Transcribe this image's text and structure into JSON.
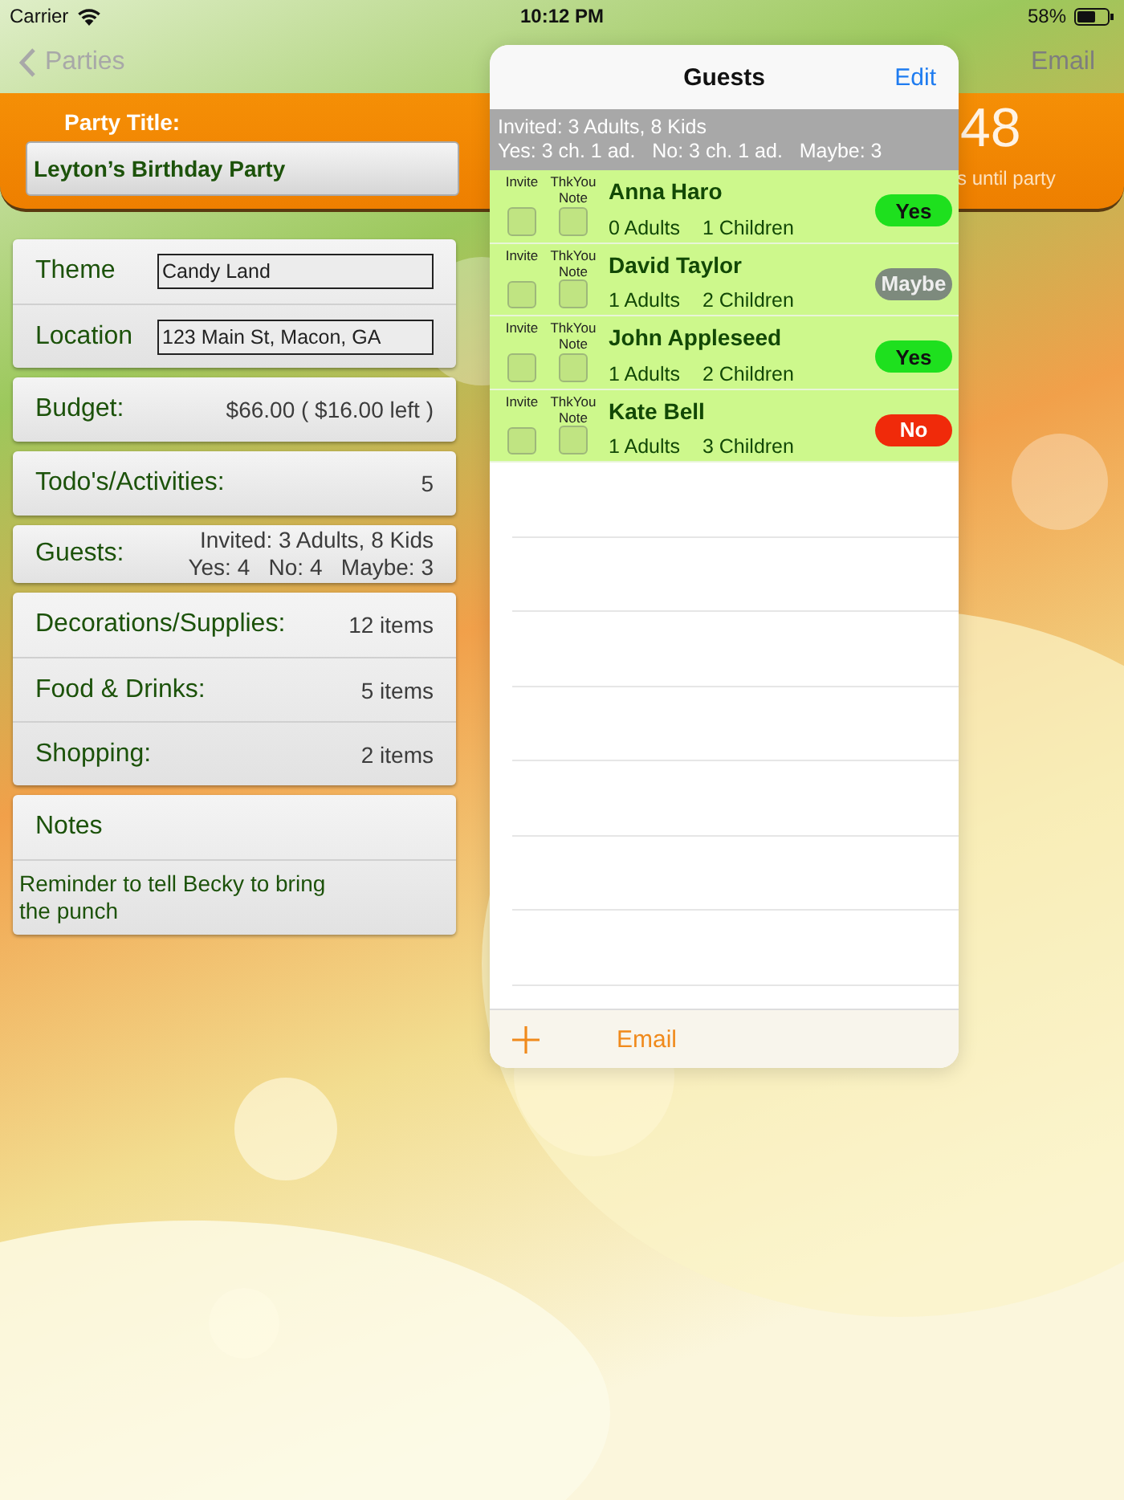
{
  "status_bar": {
    "carrier": "Carrier",
    "time": "10:12 PM",
    "battery": "58%"
  },
  "nav": {
    "back": "Parties",
    "action": "Email"
  },
  "banner": {
    "title_label": "Party Title:",
    "title_value": "Leyton’s Birthday Party",
    "countdown": "48",
    "countdown_label": "s until party"
  },
  "details": [
    {
      "label": "Theme",
      "value": "Candy Land"
    },
    {
      "label": "Location",
      "value": "123 Main St, Macon, GA"
    }
  ],
  "budget": {
    "label": "Budget:",
    "value": "$66.00 ( $16.00 left )"
  },
  "todos": {
    "label": "Todo's/Activities:",
    "value": "5"
  },
  "guests_summary": {
    "label": "Guests:",
    "line_1": "Invited: 3 Adults, 8 Kids",
    "line_2": "Yes: 4   No: 4   Maybe: 3"
  },
  "lists": [
    {
      "label": "Decorations/Supplies:",
      "value": "12 items"
    },
    {
      "label": "Food & Drinks:",
      "value": "5 items"
    },
    {
      "label": "Shopping:",
      "value": "2 items"
    }
  ],
  "notes": {
    "label": "Notes",
    "text": "Reminder to tell Becky to bring the punch"
  },
  "popover": {
    "title": "Guests",
    "edit": "Edit",
    "summary_1": "Invited: 3 Adults, 8 Kids",
    "summary_2": "Yes: 3 ch. 1 ad.   No: 3 ch. 1 ad.   Maybe: 3",
    "guests": [
      {
        "invite_label": "Invite",
        "note_label": "ThkYou Note",
        "name": "Anna Haro",
        "adults": "0 Adults",
        "children": "1 Children",
        "invited": false,
        "thanked": false,
        "response": {
          "kind": "yes",
          "label": "Yes"
        }
      },
      {
        "invite_label": "Invite",
        "note_label": "ThkYou Note",
        "name": "David Taylor",
        "adults": "1 Adults",
        "children": "2 Children",
        "invited": false,
        "thanked": false,
        "response": {
          "kind": "maybe",
          "label": "Maybe"
        }
      },
      {
        "invite_label": "Invite",
        "note_label": "ThkYou Note",
        "name": "John Appleseed",
        "adults": "1 Adults",
        "children": "2 Children",
        "invited": false,
        "thanked": false,
        "response": {
          "kind": "yes",
          "label": "Yes"
        }
      },
      {
        "invite_label": "Invite",
        "note_label": "ThkYou Note",
        "name": "Kate Bell",
        "adults": "1 Adults",
        "children": "3 Children",
        "invited": false,
        "thanked": false,
        "response": {
          "kind": "no",
          "label": "No"
        }
      }
    ],
    "footer_action": "Email"
  }
}
